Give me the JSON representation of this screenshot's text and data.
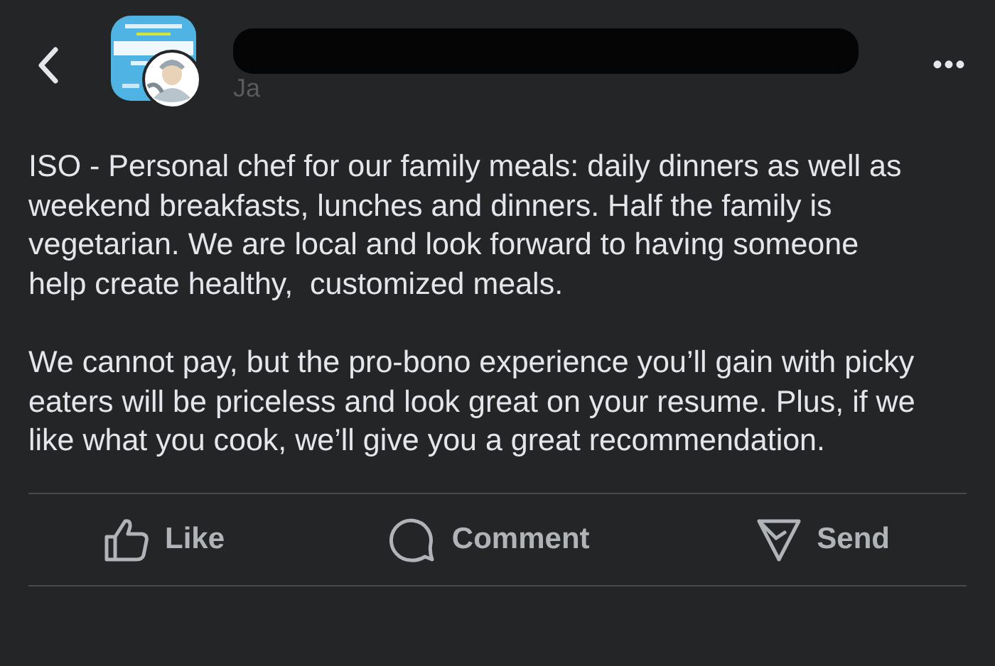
{
  "header": {
    "author_visible": "Ja",
    "more": "•••"
  },
  "post": {
    "paragraphs": [
      "ISO - Personal chef for our family meals: daily dinners as well as weekend breakfasts, lunches and dinners. Half the family is vegetarian. We are local and look forward to having someone help create healthy,  customized meals.",
      "We cannot pay, but the pro-bono experience you’ll gain with picky eaters will be priceless and look great on your resume. Plus, if we like what you cook, we’ll give you a great recommendation."
    ]
  },
  "actions": [
    {
      "kind": "like",
      "label": "Like"
    },
    {
      "kind": "comment",
      "label": "Comment"
    },
    {
      "kind": "send",
      "label": "Send"
    }
  ]
}
